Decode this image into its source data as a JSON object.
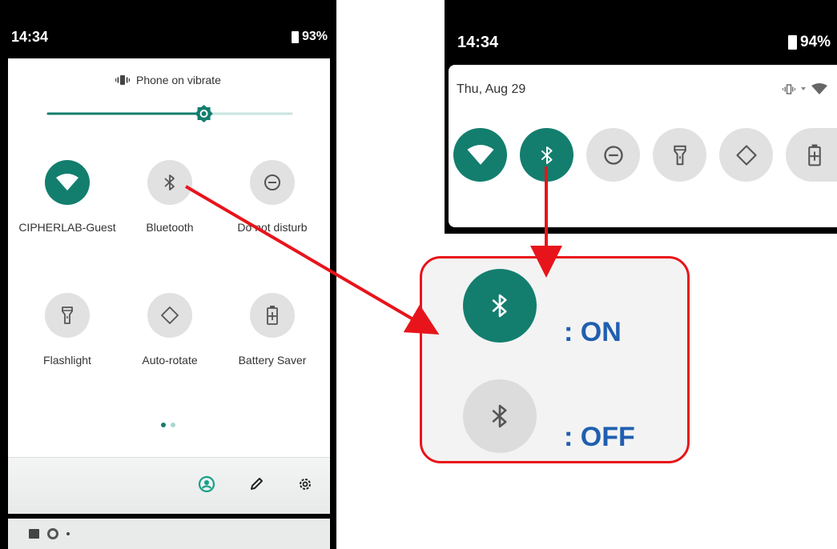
{
  "left_phone": {
    "status_time": "14:34",
    "battery_percent": "93%",
    "ringer_status": "Phone on vibrate",
    "brightness_level": 0.64,
    "tiles": [
      {
        "label": "CIPHERLAB-Guest",
        "state": "on",
        "icon": "wifi-icon"
      },
      {
        "label": "Bluetooth",
        "state": "off",
        "icon": "bluetooth-icon"
      },
      {
        "label": "Do not disturb",
        "state": "off",
        "icon": "dnd-icon"
      },
      {
        "label": "Flashlight",
        "state": "off",
        "icon": "flashlight-icon"
      },
      {
        "label": "Auto-rotate",
        "state": "off",
        "icon": "rotate-icon"
      },
      {
        "label": "Battery Saver",
        "state": "off",
        "icon": "battery-saver-icon"
      }
    ],
    "page_indicator": {
      "pages": 2,
      "current": 1
    },
    "footer_icons": [
      "user-icon",
      "edit-icon",
      "settings-icon"
    ]
  },
  "right_phone": {
    "status_time": "14:34",
    "battery_percent": "94%",
    "date": "Thu, Aug 29",
    "tiles": [
      {
        "state": "on",
        "icon": "wifi-icon"
      },
      {
        "state": "on",
        "icon": "bluetooth-icon"
      },
      {
        "state": "off",
        "icon": "dnd-icon"
      },
      {
        "state": "off",
        "icon": "flashlight-icon"
      },
      {
        "state": "off",
        "icon": "rotate-icon"
      },
      {
        "state": "off",
        "icon": "battery-saver-icon"
      }
    ]
  },
  "legend": {
    "on_text": ":  ON",
    "off_text": ":  OFF"
  },
  "colors": {
    "tile_on": "#137e6e",
    "tile_off": "#e1e1e1",
    "callout_red": "#e8141b",
    "legend_text": "#1f5fb0"
  }
}
